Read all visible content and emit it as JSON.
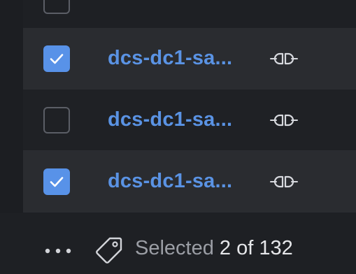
{
  "rows": [
    {
      "name": "dcs-dc1-sa...",
      "checked": true,
      "link_icon": "link-chain-icon"
    },
    {
      "name": "dcs-dc1-sa...",
      "checked": false,
      "link_icon": "link-chain-icon"
    },
    {
      "name": "dcs-dc1-sa...",
      "checked": true,
      "link_icon": "link-chain-icon"
    }
  ],
  "footer": {
    "more_icon": "more-horizontal-icon",
    "tag_icon": "tag-icon",
    "selected_label": "Selected",
    "selected_count": "2 of 132"
  },
  "colors": {
    "accent": "#5892e8",
    "link_text": "#5a93e4",
    "background": "#1e2024",
    "selected_row": "#2a2c30"
  }
}
